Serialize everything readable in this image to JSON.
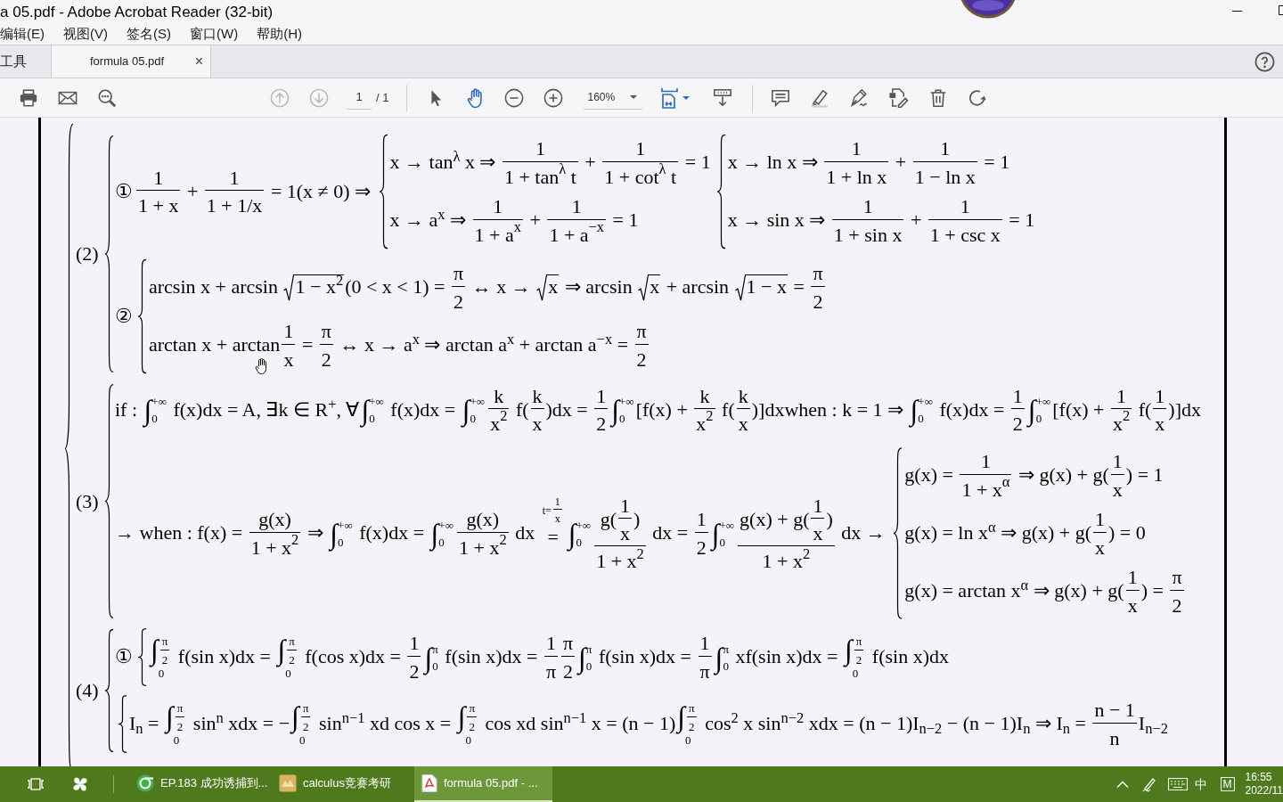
{
  "window": {
    "title": "a 05.pdf - Adobe Acrobat Reader (32-bit)"
  },
  "menu": [
    "编辑(E)",
    "视图(V)",
    "签名(S)",
    "窗口(W)",
    "帮助(H)"
  ],
  "tabs": [
    {
      "label": "工具",
      "selected": false
    },
    {
      "label": "formula 05.pdf",
      "selected": true,
      "close": "×"
    }
  ],
  "toolbar": {
    "page_up": {
      "disabled": true
    },
    "page_down": {
      "disabled": true
    },
    "page_number": "1",
    "page_count": "/ 1",
    "select_tool": {
      "selected": false
    },
    "hand_tool": {
      "selected": true
    },
    "zoom": "160%"
  },
  "document": {
    "sections": [
      {
        "label": "(2)",
        "rows": [
          {
            "marker": "①",
            "parts": [
              {
                "kind": "fraction",
                "num": "1",
                "den": "1 + x"
              },
              {
                "kind": "text",
                "text": " + "
              },
              {
                "kind": "fraction",
                "num": "1",
                "den": "1 + 1/x"
              },
              {
                "kind": "text",
                "text": " = 1(x ≠ 0) ⇒ "
              },
              {
                "kind": "cases",
                "lines": [
                  [
                    {
                      "kind": "text",
                      "text": "x → tan$^{λ}$ x ⇒ "
                    },
                    {
                      "kind": "fraction",
                      "num": "1",
                      "den": "1 + tan$^{λ}$ t"
                    },
                    {
                      "kind": "text",
                      "text": " + "
                    },
                    {
                      "kind": "fraction",
                      "num": "1",
                      "den": "1 + cot$^{λ}$ t"
                    },
                    {
                      "kind": "text",
                      "text": " = 1"
                    }
                  ],
                  [
                    {
                      "kind": "text",
                      "text": "x → a$^{x}$ ⇒ "
                    },
                    {
                      "kind": "fraction",
                      "num": "1",
                      "den": "1 + a$^{x}$"
                    },
                    {
                      "kind": "text",
                      "text": " + "
                    },
                    {
                      "kind": "fraction",
                      "num": "1",
                      "den": "1 + a$^{−x}$"
                    },
                    {
                      "kind": "text",
                      "text": " = 1"
                    }
                  ]
                ]
              },
              {
                "kind": "cases",
                "lines": [
                  [
                    {
                      "kind": "text",
                      "text": "x → ln x ⇒ "
                    },
                    {
                      "kind": "fraction",
                      "num": "1",
                      "den": "1 + ln x"
                    },
                    {
                      "kind": "text",
                      "text": " + "
                    },
                    {
                      "kind": "fraction",
                      "num": "1",
                      "den": "1 − ln x"
                    },
                    {
                      "kind": "text",
                      "text": " = 1"
                    }
                  ],
                  [
                    {
                      "kind": "text",
                      "text": "x → sin x ⇒ "
                    },
                    {
                      "kind": "fraction",
                      "num": "1",
                      "den": "1 + sin x"
                    },
                    {
                      "kind": "text",
                      "text": " + "
                    },
                    {
                      "kind": "fraction",
                      "num": "1",
                      "den": "1 + csc x"
                    },
                    {
                      "kind": "text",
                      "text": " = 1"
                    }
                  ]
                ]
              }
            ]
          },
          {
            "marker": "②",
            "parts": [
              {
                "kind": "cases",
                "lines": [
                  [
                    {
                      "kind": "text",
                      "text": "arcsin x + arcsin "
                    },
                    {
                      "kind": "root",
                      "body": "1 − x$^{2}$"
                    },
                    {
                      "kind": "text",
                      "text": "(0 < x < 1) = "
                    },
                    {
                      "kind": "fraction",
                      "num": "π",
                      "den": "2"
                    },
                    {
                      "kind": "text",
                      "text": " ↔ x → "
                    },
                    {
                      "kind": "root",
                      "body": "x"
                    },
                    {
                      "kind": "text",
                      "text": " ⇒ arcsin "
                    },
                    {
                      "kind": "root",
                      "body": "x"
                    },
                    {
                      "kind": "text",
                      "text": " + arcsin "
                    },
                    {
                      "kind": "root",
                      "body": "1 − x"
                    },
                    {
                      "kind": "text",
                      "text": " = "
                    },
                    {
                      "kind": "fraction",
                      "num": "π",
                      "den": "2"
                    }
                  ],
                  [
                    {
                      "kind": "text",
                      "text": "arctan x + arctan"
                    },
                    {
                      "kind": "fraction",
                      "num": "1",
                      "den": "x"
                    },
                    {
                      "kind": "text",
                      "text": " = "
                    },
                    {
                      "kind": "fraction",
                      "num": "π",
                      "den": "2"
                    },
                    {
                      "kind": "text",
                      "text": " ↔ x → a$^{x}$ ⇒ arctan a$^{x}$ + arctan a$^{−x}$ = "
                    },
                    {
                      "kind": "fraction",
                      "num": "π",
                      "den": "2"
                    }
                  ]
                ]
              }
            ]
          }
        ]
      },
      {
        "label": "(3)",
        "rows": [
          {
            "parts": [
              {
                "kind": "text",
                "text": "if : "
              },
              {
                "kind": "integral",
                "sign": "∫",
                "lo": "0",
                "hi": "+∞"
              },
              {
                "kind": "text",
                "text": " f(x)dx = A, ∃k ∈ R$^{+}$, ∀"
              },
              {
                "kind": "integral",
                "sign": "∫",
                "lo": "0",
                "hi": "+∞"
              },
              {
                "kind": "text",
                "text": " f(x)dx = "
              },
              {
                "kind": "integral",
                "sign": "∫",
                "lo": "0",
                "hi": "+∞"
              },
              {
                "kind": "fraction",
                "num": "k",
                "den": "x$^{2}$"
              },
              {
                "kind": "text",
                "text": " f("
              },
              {
                "kind": "fraction",
                "num": "k",
                "den": "x"
              },
              {
                "kind": "text",
                "text": ")dx = "
              },
              {
                "kind": "fraction",
                "num": "1",
                "den": "2"
              },
              {
                "kind": "integral",
                "sign": "∫",
                "lo": "0",
                "hi": "+∞"
              },
              {
                "kind": "text",
                "text": "[f(x) + "
              },
              {
                "kind": "fraction",
                "num": "k",
                "den": "x$^{2}$"
              },
              {
                "kind": "text",
                "text": " f("
              },
              {
                "kind": "fraction",
                "num": "k",
                "den": "x"
              },
              {
                "kind": "text",
                "text": ")]dxwhen : k = 1 ⇒ "
              },
              {
                "kind": "integral",
                "sign": "∫",
                "lo": "0",
                "hi": "+∞"
              },
              {
                "kind": "text",
                "text": " f(x)dx = "
              },
              {
                "kind": "fraction",
                "num": "1",
                "den": "2"
              },
              {
                "kind": "integral",
                "sign": "∫",
                "lo": "0",
                "hi": "+∞"
              },
              {
                "kind": "text",
                "text": "[f(x) + "
              },
              {
                "kind": "fraction",
                "num": "1",
                "den": "x$^{2}$"
              },
              {
                "kind": "text",
                "text": " f("
              },
              {
                "kind": "fraction",
                "num": "1",
                "den": "x"
              },
              {
                "kind": "text",
                "text": ")]dx"
              }
            ]
          },
          {
            "parts": [
              {
                "kind": "text",
                "text": "→ when : f(x) = "
              },
              {
                "kind": "fraction",
                "num": "g(x)",
                "den": "1 + x$^{2}$"
              },
              {
                "kind": "text",
                "text": " ⇒ "
              },
              {
                "kind": "integral",
                "sign": "∫",
                "lo": "0",
                "hi": "+∞"
              },
              {
                "kind": "text",
                "text": " f(x)dx = "
              },
              {
                "kind": "integral",
                "sign": "∫",
                "lo": "0",
                "hi": "+∞"
              },
              {
                "kind": "fraction",
                "num": "g(x)",
                "den": "1 + x$^{2}$"
              },
              {
                "kind": "text",
                "text": " dx "
              },
              {
                "kind": "stack",
                "sign": "=",
                "over": [
                  {
                    "kind": "text",
                    "text": "t="
                  },
                  {
                    "kind": "fraction",
                    "num": "1",
                    "den": "x"
                  }
                ]
              },
              {
                "kind": "integral",
                "sign": "∫",
                "lo": "0",
                "hi": "+∞"
              },
              {
                "kind": "fraction",
                "num": [
                  {
                    "kind": "text",
                    "text": "g("
                  },
                  {
                    "kind": "fraction",
                    "num": "1",
                    "den": "x"
                  },
                  {
                    "kind": "text",
                    "text": ")"
                  }
                ],
                "den": "1 + x$^{2}$"
              },
              {
                "kind": "text",
                "text": " dx = "
              },
              {
                "kind": "fraction",
                "num": "1",
                "den": "2"
              },
              {
                "kind": "integral",
                "sign": "∫",
                "lo": "0",
                "hi": "+∞"
              },
              {
                "kind": "fraction",
                "num": [
                  {
                    "kind": "text",
                    "text": "g(x) + g("
                  },
                  {
                    "kind": "fraction",
                    "num": "1",
                    "den": "x"
                  },
                  {
                    "kind": "text",
                    "text": ")"
                  }
                ],
                "den": "1 + x$^{2}$"
              },
              {
                "kind": "text",
                "text": " dx → "
              },
              {
                "kind": "cases",
                "lines": [
                  [
                    {
                      "kind": "text",
                      "text": "g(x) = "
                    },
                    {
                      "kind": "fraction",
                      "num": "1",
                      "den": "1 + x$^{α}$"
                    },
                    {
                      "kind": "text",
                      "text": " ⇒ g(x) + g("
                    },
                    {
                      "kind": "fraction",
                      "num": "1",
                      "den": "x"
                    },
                    {
                      "kind": "text",
                      "text": ") = 1"
                    }
                  ],
                  [
                    {
                      "kind": "text",
                      "text": "g(x) = ln x$^{α}$ ⇒ g(x) + g("
                    },
                    {
                      "kind": "fraction",
                      "num": "1",
                      "den": "x"
                    },
                    {
                      "kind": "text",
                      "text": ") = 0"
                    }
                  ],
                  [
                    {
                      "kind": "text",
                      "text": "g(x) = arctan x$^{α}$ ⇒ g(x) + g("
                    },
                    {
                      "kind": "fraction",
                      "num": "1",
                      "den": "x"
                    },
                    {
                      "kind": "text",
                      "text": ") = "
                    },
                    {
                      "kind": "fraction",
                      "num": "π",
                      "den": "2"
                    }
                  ]
                ]
              }
            ]
          }
        ]
      },
      {
        "label": "(4)",
        "rows": [
          {
            "marker": "①",
            "parts": [
              {
                "kind": "cases",
                "lines": [
                  [
                    {
                      "kind": "integral",
                      "sign": "∫",
                      "lo": "0",
                      "hi": [
                        {
                          "kind": "fraction",
                          "num": "π",
                          "den": "2"
                        }
                      ]
                    },
                    {
                      "kind": "text",
                      "text": " f(sin x)dx = "
                    },
                    {
                      "kind": "integral",
                      "sign": "∫",
                      "lo": "0",
                      "hi": [
                        {
                          "kind": "fraction",
                          "num": "π",
                          "den": "2"
                        }
                      ]
                    },
                    {
                      "kind": "text",
                      "text": " f(cos x)dx = "
                    },
                    {
                      "kind": "fraction",
                      "num": "1",
                      "den": "2"
                    },
                    {
                      "kind": "integral",
                      "sign": "∫",
                      "lo": "0",
                      "hi": "π"
                    },
                    {
                      "kind": "text",
                      "text": " f(sin x)dx = "
                    },
                    {
                      "kind": "fraction",
                      "num": "1",
                      "den": "π"
                    },
                    {
                      "kind": "fraction",
                      "num": "π",
                      "den": "2"
                    },
                    {
                      "kind": "integral",
                      "sign": "∫",
                      "lo": "0",
                      "hi": "π"
                    },
                    {
                      "kind": "text",
                      "text": " f(sin x)dx = "
                    },
                    {
                      "kind": "fraction",
                      "num": "1",
                      "den": "π"
                    },
                    {
                      "kind": "integral",
                      "sign": "∫",
                      "lo": "0",
                      "hi": "π"
                    },
                    {
                      "kind": "text",
                      "text": " xf(sin x)dx = "
                    },
                    {
                      "kind": "integral",
                      "sign": "∫",
                      "lo": "0",
                      "hi": [
                        {
                          "kind": "fraction",
                          "num": "π",
                          "den": "2"
                        }
                      ]
                    },
                    {
                      "kind": "text",
                      "text": " f(sin x)dx"
                    }
                  ]
                ]
              }
            ]
          },
          {
            "parts": [
              {
                "kind": "cases",
                "lines": [
                  [
                    {
                      "kind": "text",
                      "text": "I$_{n}$ = "
                    },
                    {
                      "kind": "integral",
                      "sign": "∫",
                      "lo": "0",
                      "hi": [
                        {
                          "kind": "fraction",
                          "num": "π",
                          "den": "2"
                        }
                      ]
                    },
                    {
                      "kind": "text",
                      "text": " sin$^{n}$ xdx = −"
                    },
                    {
                      "kind": "integral",
                      "sign": "∫",
                      "lo": "0",
                      "hi": [
                        {
                          "kind": "fraction",
                          "num": "π",
                          "den": "2"
                        }
                      ]
                    },
                    {
                      "kind": "text",
                      "text": " sin$^{n−1}$ xd cos x = "
                    },
                    {
                      "kind": "integral",
                      "sign": "∫",
                      "lo": "0",
                      "hi": [
                        {
                          "kind": "fraction",
                          "num": "π",
                          "den": "2"
                        }
                      ]
                    },
                    {
                      "kind": "text",
                      "text": " cos xd sin$^{n−1}$ x = (n − 1)"
                    },
                    {
                      "kind": "integral",
                      "sign": "∫",
                      "lo": "0",
                      "hi": [
                        {
                          "kind": "fraction",
                          "num": "π",
                          "den": "2"
                        }
                      ]
                    },
                    {
                      "kind": "text",
                      "text": " cos$^{2}$ x sin$^{n−2}$ xdx = (n − 1)I$_{n−2}$ − (n − 1)I$_{n}$ ⇒ I$_{n}$ = "
                    },
                    {
                      "kind": "fraction",
                      "num": "n − 1",
                      "den": "n"
                    },
                    {
                      "kind": "text",
                      "text": "I$_{n−2}$"
                    }
                  ]
                ]
              }
            ]
          }
        ]
      }
    ]
  },
  "taskbar": {
    "apps": [
      {
        "label": "EP.183 成功诱捕到...",
        "selected": false
      },
      {
        "label": "calculus竞赛考研",
        "selected": false
      },
      {
        "label": "formula 05.pdf - ...",
        "selected": true
      }
    ],
    "ime": "中",
    "ime_mode": "M",
    "time": "16:55",
    "date": "2022/11"
  }
}
